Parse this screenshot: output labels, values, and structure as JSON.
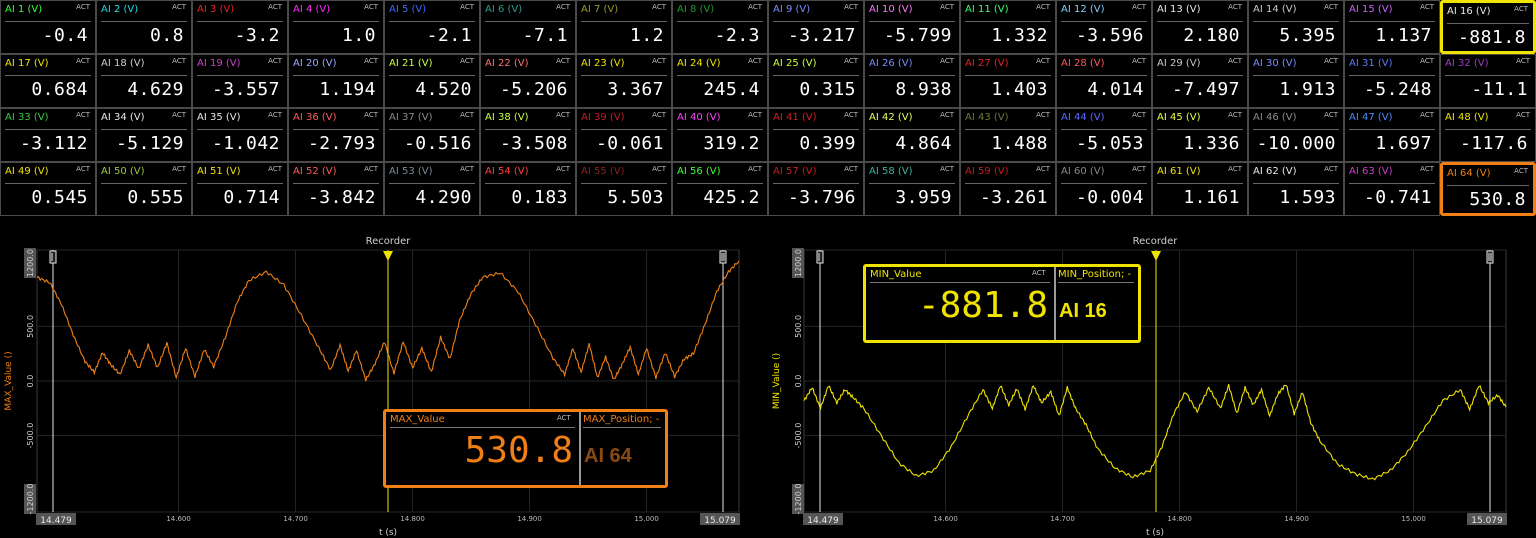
{
  "tiles": [
    {
      "name": "AI 1 (V)",
      "value": "-0.4",
      "color": "#39ff39"
    },
    {
      "name": "AI 2 (V)",
      "value": "0.8",
      "color": "#22d8e8"
    },
    {
      "name": "AI 3 (V)",
      "value": "-3.2",
      "color": "#e02424"
    },
    {
      "name": "AI 4 (V)",
      "value": "1.0",
      "color": "#ff2dff"
    },
    {
      "name": "AI 5 (V)",
      "value": "-2.1",
      "color": "#3a6bff"
    },
    {
      "name": "AI 6 (V)",
      "value": "-7.1",
      "color": "#2f9b8a"
    },
    {
      "name": "AI 7 (V)",
      "value": "1.2",
      "color": "#9a9a2a"
    },
    {
      "name": "AI 8 (V)",
      "value": "-2.3",
      "color": "#1f9a2a"
    },
    {
      "name": "AI 9 (V)",
      "value": "-3.217",
      "color": "#7d8cff"
    },
    {
      "name": "AI 10 (V)",
      "value": "-5.799",
      "color": "#ff7aff"
    },
    {
      "name": "AI 11 (V)",
      "value": "1.332",
      "color": "#3cff6a"
    },
    {
      "name": "AI 12 (V)",
      "value": "-3.596",
      "color": "#7fd0ff"
    },
    {
      "name": "AI 13 (V)",
      "value": "2.180",
      "color": "#e8e8e8"
    },
    {
      "name": "AI 14 (V)",
      "value": "5.395",
      "color": "#c8c8c8"
    },
    {
      "name": "AI 15 (V)",
      "value": "1.137",
      "color": "#d060ff"
    },
    {
      "name": "AI 16 (V)",
      "value": "-881.8",
      "color": "#e8e8e8"
    },
    {
      "name": "AI 17 (V)",
      "value": "0.684",
      "color": "#f0e300"
    },
    {
      "name": "AI 18 (V)",
      "value": "4.629",
      "color": "#cfcfcf"
    },
    {
      "name": "AI 19 (V)",
      "value": "-3.557",
      "color": "#d040d0"
    },
    {
      "name": "AI 20 (V)",
      "value": "1.194",
      "color": "#9aa8ff"
    },
    {
      "name": "AI 21 (V)",
      "value": "4.520",
      "color": "#c8ff40"
    },
    {
      "name": "AI 22 (V)",
      "value": "-5.206",
      "color": "#ff7070"
    },
    {
      "name": "AI 23 (V)",
      "value": "3.367",
      "color": "#f0e300"
    },
    {
      "name": "AI 24 (V)",
      "value": "245.4",
      "color": "#f0e300"
    },
    {
      "name": "AI 25 (V)",
      "value": "0.315",
      "color": "#c8ff40"
    },
    {
      "name": "AI 26 (V)",
      "value": "8.938",
      "color": "#7a8cff"
    },
    {
      "name": "AI 27 (V)",
      "value": "1.403",
      "color": "#e02424"
    },
    {
      "name": "AI 28 (V)",
      "value": "4.014",
      "color": "#ff5a5a"
    },
    {
      "name": "AI 29 (V)",
      "value": "-7.497",
      "color": "#c8c8c8"
    },
    {
      "name": "AI 30 (V)",
      "value": "1.913",
      "color": "#7a8cff"
    },
    {
      "name": "AI 31 (V)",
      "value": "-5.248",
      "color": "#5a7aff"
    },
    {
      "name": "AI 32 (V)",
      "value": "-11.1",
      "color": "#9a40c0"
    },
    {
      "name": "AI 33 (V)",
      "value": "-3.112",
      "color": "#39c840"
    },
    {
      "name": "AI 34 (V)",
      "value": "-5.129",
      "color": "#e8e8e8"
    },
    {
      "name": "AI 35 (V)",
      "value": "-1.042",
      "color": "#e8e8e8"
    },
    {
      "name": "AI 36 (V)",
      "value": "-2.793",
      "color": "#ff5a5a"
    },
    {
      "name": "AI 37 (V)",
      "value": "-0.516",
      "color": "#8a8a8a"
    },
    {
      "name": "AI 38 (V)",
      "value": "-3.508",
      "color": "#c8ff40"
    },
    {
      "name": "AI 39 (V)",
      "value": "-0.061",
      "color": "#c02020"
    },
    {
      "name": "AI 40 (V)",
      "value": "319.2",
      "color": "#ff40ff"
    },
    {
      "name": "AI 41 (V)",
      "value": "0.399",
      "color": "#d02020"
    },
    {
      "name": "AI 42 (V)",
      "value": "4.864",
      "color": "#e8ff60"
    },
    {
      "name": "AI 43 (V)",
      "value": "1.488",
      "color": "#6a7a3a"
    },
    {
      "name": "AI 44 (V)",
      "value": "-5.053",
      "color": "#5a6aff"
    },
    {
      "name": "AI 45 (V)",
      "value": "1.336",
      "color": "#e8ff40"
    },
    {
      "name": "AI 46 (V)",
      "value": "-10.000",
      "color": "#8a8a8a"
    },
    {
      "name": "AI 47 (V)",
      "value": "1.697",
      "color": "#4a8aff"
    },
    {
      "name": "AI 48 (V)",
      "value": "-117.6",
      "color": "#f0e300"
    },
    {
      "name": "AI 49 (V)",
      "value": "0.545",
      "color": "#f0e300"
    },
    {
      "name": "AI 50 (V)",
      "value": "0.555",
      "color": "#9ac840"
    },
    {
      "name": "AI 51 (V)",
      "value": "0.714",
      "color": "#f0e300"
    },
    {
      "name": "AI 52 (V)",
      "value": "-3.842",
      "color": "#ff5a5a"
    },
    {
      "name": "AI 53 (V)",
      "value": "4.290",
      "color": "#7a8a9a"
    },
    {
      "name": "AI 54 (V)",
      "value": "0.183",
      "color": "#ff4040"
    },
    {
      "name": "AI 55 (V)",
      "value": "5.503",
      "color": "#8a2020"
    },
    {
      "name": "AI 56 (V)",
      "value": "425.2",
      "color": "#39ff39"
    },
    {
      "name": "AI 57 (V)",
      "value": "-3.796",
      "color": "#c02020"
    },
    {
      "name": "AI 58 (V)",
      "value": "3.959",
      "color": "#40b0a0"
    },
    {
      "name": "AI 59 (V)",
      "value": "-3.261",
      "color": "#c02020"
    },
    {
      "name": "AI 60 (V)",
      "value": "-0.004",
      "color": "#8a8a8a"
    },
    {
      "name": "AI 61 (V)",
      "value": "1.161",
      "color": "#f0e300"
    },
    {
      "name": "AI 62 (V)",
      "value": "1.593",
      "color": "#e8e8e8"
    },
    {
      "name": "AI 63 (V)",
      "value": "-0.741",
      "color": "#d040d0"
    },
    {
      "name": "AI 64 (V)",
      "value": "530.8",
      "color": "#f07f16"
    }
  ],
  "tile_act_label": "ACT",
  "recorders": [
    {
      "title": "Recorder",
      "ylabel": "MAX_Value ()",
      "xlabel": "t (s)",
      "color": "#f07f16",
      "x_start": "14.479",
      "x_end": "15.079",
      "x_ticks": [
        "14.600",
        "14.700",
        "14.800",
        "14.900",
        "15.000"
      ],
      "y_ticks": [
        "1200.0",
        "500.0",
        "0.0",
        "-500.0",
        "-1200.0"
      ],
      "widget": {
        "name": "MAX_Value",
        "act": "ACT",
        "value": "530.8",
        "pos_name": "MAX_Position; -",
        "pos_value": "AI 64",
        "border": "#f07f16",
        "value_color": "#f07f16",
        "pos_color": "#8a4a14"
      }
    },
    {
      "title": "Recorder",
      "ylabel": "MIN_Value ()",
      "xlabel": "t (s)",
      "color": "#f0e300",
      "x_start": "14.479",
      "x_end": "15.079",
      "x_ticks": [
        "14.600",
        "14.700",
        "14.800",
        "14.900",
        "15.000"
      ],
      "y_ticks": [
        "1200.0",
        "500.0",
        "0.0",
        "-500.0",
        "-1200.0"
      ],
      "widget": {
        "name": "MIN_Value",
        "act": "ACT",
        "value": "-881.8",
        "pos_name": "MIN_Position; -",
        "pos_value": "AI 16",
        "border": "#f0e300",
        "value_color": "#f0e300",
        "pos_color": "#f0e300"
      }
    }
  ],
  "chart_data": [
    {
      "type": "line",
      "title": "Recorder",
      "xlabel": "t (s)",
      "ylabel": "MAX_Value ()",
      "xlim": [
        14.479,
        15.079
      ],
      "ylim": [
        -1200,
        1200
      ],
      "grid": true,
      "series": [
        {
          "color": "#f07f16",
          "x": [
            14.479,
            14.49,
            14.5,
            14.51,
            14.52,
            14.528,
            14.535,
            14.542,
            14.55,
            14.558,
            14.566,
            14.574,
            14.582,
            14.59,
            14.598,
            14.606,
            14.614,
            14.622,
            14.63,
            14.64,
            14.65,
            14.66,
            14.675,
            14.69,
            14.705,
            14.72,
            14.73,
            14.738,
            14.745,
            14.752,
            14.76,
            14.768,
            14.776,
            14.784,
            14.792,
            14.8,
            14.808,
            14.816,
            14.824,
            14.832,
            14.84,
            14.85,
            14.86,
            14.875,
            14.89,
            14.905,
            14.92,
            14.93,
            14.937,
            14.944,
            14.951,
            14.958,
            14.965,
            14.972,
            14.979,
            14.986,
            14.993,
            15.0,
            15.008,
            15.016,
            15.024,
            15.032,
            15.04,
            15.05,
            15.06,
            15.07,
            15.079
          ],
          "y": [
            950,
            900,
            700,
            420,
            180,
            80,
            260,
            150,
            60,
            280,
            110,
            330,
            120,
            350,
            30,
            300,
            40,
            290,
            130,
            400,
            720,
            920,
            1000,
            880,
            600,
            300,
            100,
            330,
            90,
            280,
            10,
            160,
            360,
            70,
            360,
            120,
            300,
            80,
            400,
            200,
            550,
            800,
            950,
            990,
            820,
            520,
            210,
            60,
            300,
            80,
            340,
            30,
            220,
            10,
            150,
            310,
            60,
            300,
            30,
            260,
            40,
            200,
            250,
            520,
            820,
            1000,
            1100
          ]
        }
      ]
    },
    {
      "type": "line",
      "title": "Recorder",
      "xlabel": "t (s)",
      "ylabel": "MIN_Value ()",
      "xlim": [
        14.479,
        15.079
      ],
      "ylim": [
        -1200,
        1200
      ],
      "grid": true,
      "series": [
        {
          "color": "#f0e300",
          "x": [
            14.479,
            14.486,
            14.493,
            14.5,
            14.507,
            14.514,
            14.521,
            14.53,
            14.545,
            14.56,
            14.575,
            14.59,
            14.605,
            14.62,
            14.632,
            14.64,
            14.647,
            14.654,
            14.661,
            14.668,
            14.675,
            14.682,
            14.69,
            14.697,
            14.704,
            14.711,
            14.72,
            14.73,
            14.745,
            14.76,
            14.775,
            14.785,
            14.795,
            14.805,
            14.815,
            14.825,
            14.835,
            14.842,
            14.849,
            14.856,
            14.863,
            14.87,
            14.877,
            14.884,
            14.891,
            14.898,
            14.905,
            14.912,
            14.92,
            14.935,
            14.95,
            14.965,
            14.98,
            14.995,
            15.01,
            15.025,
            15.04,
            15.048,
            15.056,
            15.064,
            15.072,
            15.079
          ],
          "y": [
            -180,
            -60,
            -250,
            -40,
            -200,
            -80,
            -150,
            -250,
            -500,
            -750,
            -870,
            -820,
            -600,
            -300,
            -80,
            -250,
            -40,
            -220,
            -70,
            -260,
            -40,
            -200,
            -100,
            -320,
            -60,
            -250,
            -400,
            -620,
            -800,
            -880,
            -820,
            -600,
            -300,
            -100,
            -280,
            -60,
            -250,
            -40,
            -300,
            -60,
            -220,
            -80,
            -320,
            -120,
            -30,
            -300,
            -100,
            -380,
            -550,
            -760,
            -850,
            -900,
            -820,
            -650,
            -420,
            -180,
            -80,
            -260,
            -40,
            -200,
            -130,
            -240
          ]
        }
      ]
    }
  ]
}
